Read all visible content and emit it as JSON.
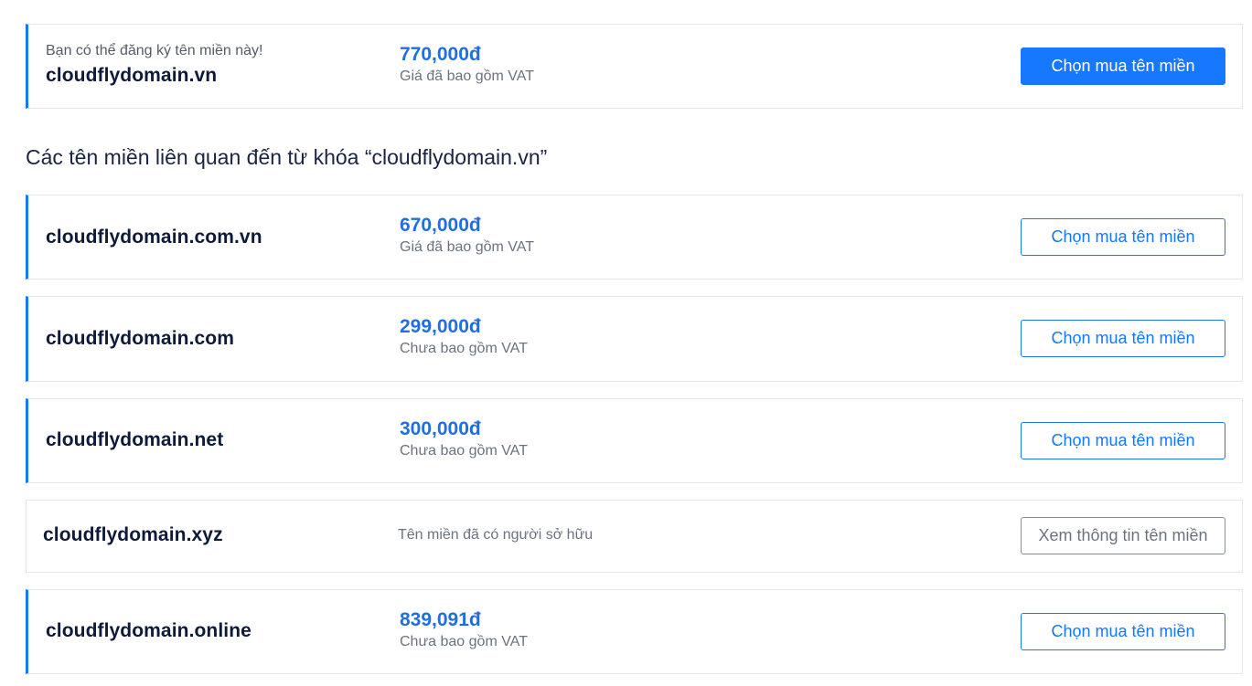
{
  "primary": {
    "hint": "Bạn có thể đăng ký tên miền này!",
    "domain": "cloudflydomain.vn",
    "price": "770,000đ",
    "vat": "Giá đã bao gồm VAT",
    "button": "Chọn mua tên miền"
  },
  "related_title": "Các tên miền liên quan đến từ khóa “cloudflydomain.vn”",
  "related": [
    {
      "domain": "cloudflydomain.com.vn",
      "price": "670,000đ",
      "vat": "Giá đã bao gồm VAT",
      "button": "Chọn mua tên miền"
    },
    {
      "domain": "cloudflydomain.com",
      "price": "299,000đ",
      "vat": "Chưa bao gồm VAT",
      "button": "Chọn mua tên miền"
    },
    {
      "domain": "cloudflydomain.net",
      "price": "300,000đ",
      "vat": "Chưa bao gồm VAT",
      "button": "Chọn mua tên miền"
    },
    {
      "domain": "cloudflydomain.xyz",
      "status": "Tên miền đã có người sở hữu",
      "button": "Xem thông tin tên miền"
    },
    {
      "domain": "cloudflydomain.online",
      "price": "839,091đ",
      "vat": "Chưa bao gồm VAT",
      "button": "Chọn mua tên miền"
    }
  ],
  "colors": {
    "accent": "#1677ff",
    "price": "#1f6fe0",
    "text_dark": "#0e1a3a"
  }
}
